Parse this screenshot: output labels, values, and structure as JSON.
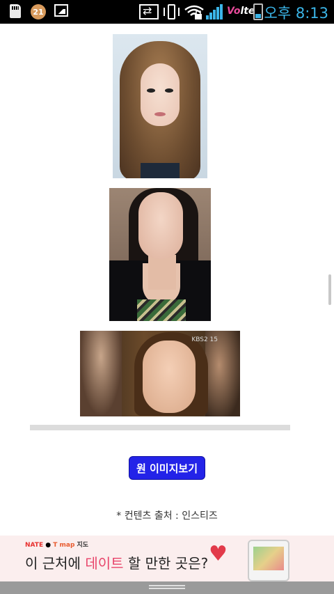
{
  "status_bar": {
    "notification_badge": "21",
    "network_label_prefix": "Vo",
    "network_label_suffix": "lte",
    "time": "오후 8:13",
    "icons": [
      "sd-card-icon",
      "paw-icon",
      "gallery-icon",
      "data-sync-icon",
      "vibrate-icon",
      "wifi-lock-icon",
      "signal-icon",
      "volte-icon",
      "battery-icon"
    ],
    "accent_color": "#3bb5e8"
  },
  "article": {
    "images": [
      {
        "name": "photo-portrait-1"
      },
      {
        "name": "photo-selfie-2"
      },
      {
        "name": "photo-broadcast-3",
        "logo": "KBS2 15"
      }
    ],
    "original_image_button": "원 이미지보기",
    "source_credit": "* 컨텐츠 출처 : 인스티즈"
  },
  "ad": {
    "brand_nate": "NATE",
    "brand_tmap": "T map",
    "brand_map": "지도",
    "headline_pre": "이 근처에 ",
    "headline_highlight": "데이트",
    "headline_post": " 할 만한 곳은?",
    "highlight_color": "#e8446a"
  },
  "button_color": "#2323e8"
}
